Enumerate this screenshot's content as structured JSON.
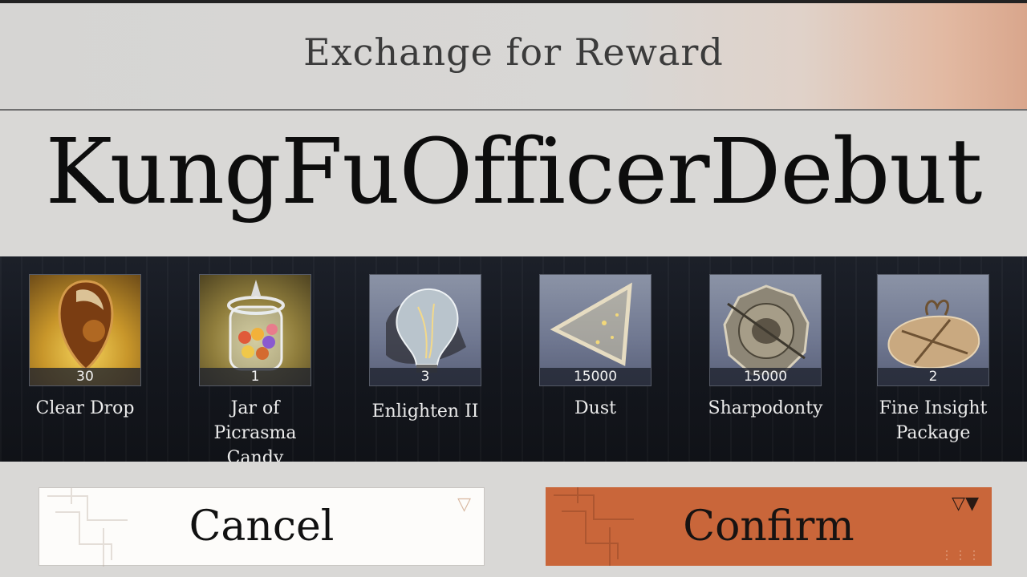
{
  "dialog": {
    "title": "Exchange for Reward"
  },
  "overlay": {
    "caption": "KungFuOfficerDebut"
  },
  "rewards": [
    {
      "name": "Clear Drop",
      "count": "30",
      "icon": "amber-drop-icon",
      "tile": "gold"
    },
    {
      "name": "Jar of Picrasma Candy",
      "count": "1",
      "icon": "candy-jar-icon",
      "tile": "olive"
    },
    {
      "name": "Enlighten II",
      "count": "3",
      "icon": "light-bulb-icon",
      "tile": "slate"
    },
    {
      "name": "Dust",
      "count": "15000",
      "icon": "glass-triangle-icon",
      "tile": "slate"
    },
    {
      "name": "Sharpodonty",
      "count": "15000",
      "icon": "coin-icon",
      "tile": "slate"
    },
    {
      "name": "Fine Insight Package",
      "count": "2",
      "icon": "parcel-icon",
      "tile": "slate"
    }
  ],
  "buttons": {
    "cancel_label": "Cancel",
    "confirm_label": "Confirm"
  },
  "colors": {
    "confirm": "#c9663a",
    "cancel": "#fdfcfa",
    "rarity_gold": "#e8b84a",
    "rarity_slate": "#7b86a6"
  }
}
